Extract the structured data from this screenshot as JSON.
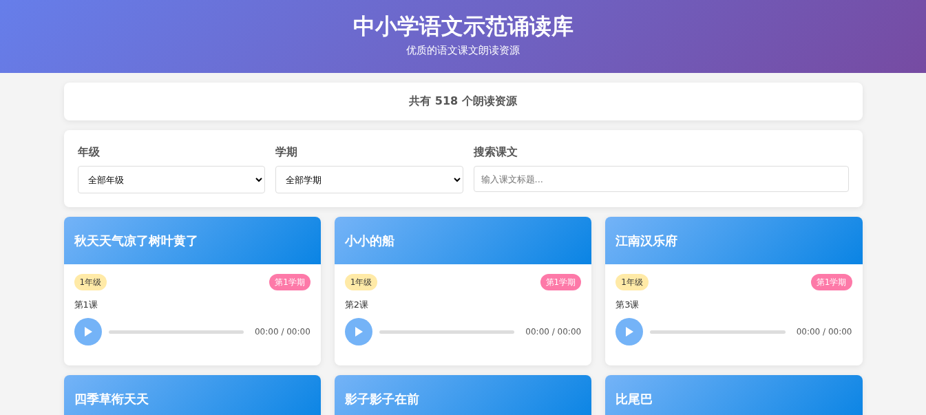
{
  "header": {
    "title": "中小学语文示范诵读库",
    "subtitle": "优质的语文课文朗读资源"
  },
  "stats": {
    "text": "共有 518 个朗读资源"
  },
  "filters": [
    {
      "kind": "select",
      "label": "年级",
      "value": "全部年级"
    },
    {
      "kind": "select",
      "label": "学期",
      "value": "全部学期"
    },
    {
      "kind": "search",
      "label": "搜索课文",
      "placeholder": "输入课文标题..."
    }
  ],
  "cards": [
    {
      "title": "秋天天气凉了树叶黄了",
      "grade": "1年级",
      "term": "第1学期",
      "lesson": "第1课",
      "level": 0,
      "time": "00:00 / 00:00"
    },
    {
      "title": "小小的船",
      "grade": "1年级",
      "term": "第1学期",
      "lesson": "第2课",
      "level": 0,
      "time": "00:00 / 00:00"
    },
    {
      "title": "江南汉乐府",
      "grade": "1年级",
      "term": "第1学期",
      "lesson": "第3课",
      "level": 0,
      "time": "00:00 / 00:00"
    },
    {
      "title": "四季草衔天天"
    },
    {
      "title": "影子影子在前"
    },
    {
      "title": "比尾巴"
    }
  ]
}
